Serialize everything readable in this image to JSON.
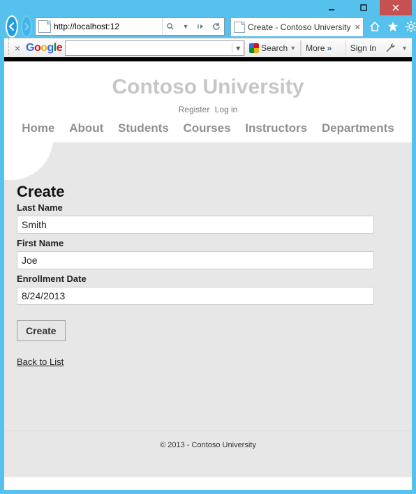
{
  "window": {
    "url": "http://localhost:12",
    "tab_title": "Create - Contoso University"
  },
  "google_toolbar": {
    "search_label": "Search",
    "more_label": "More",
    "signin_label": "Sign In"
  },
  "site": {
    "title": "Contoso University",
    "register_label": "Register",
    "login_label": "Log in",
    "nav": {
      "home": "Home",
      "about": "About",
      "students": "Students",
      "courses": "Courses",
      "instructors": "Instructors",
      "departments": "Departments"
    }
  },
  "page": {
    "heading": "Create",
    "labels": {
      "last_name": "Last Name",
      "first_name": "First Name",
      "enrollment_date": "Enrollment Date"
    },
    "values": {
      "last_name": "Smith",
      "first_name": "Joe",
      "enrollment_date": "8/24/2013"
    },
    "create_button": "Create",
    "back_link": "Back to List"
  },
  "footer": {
    "text": "© 2013 - Contoso University"
  }
}
